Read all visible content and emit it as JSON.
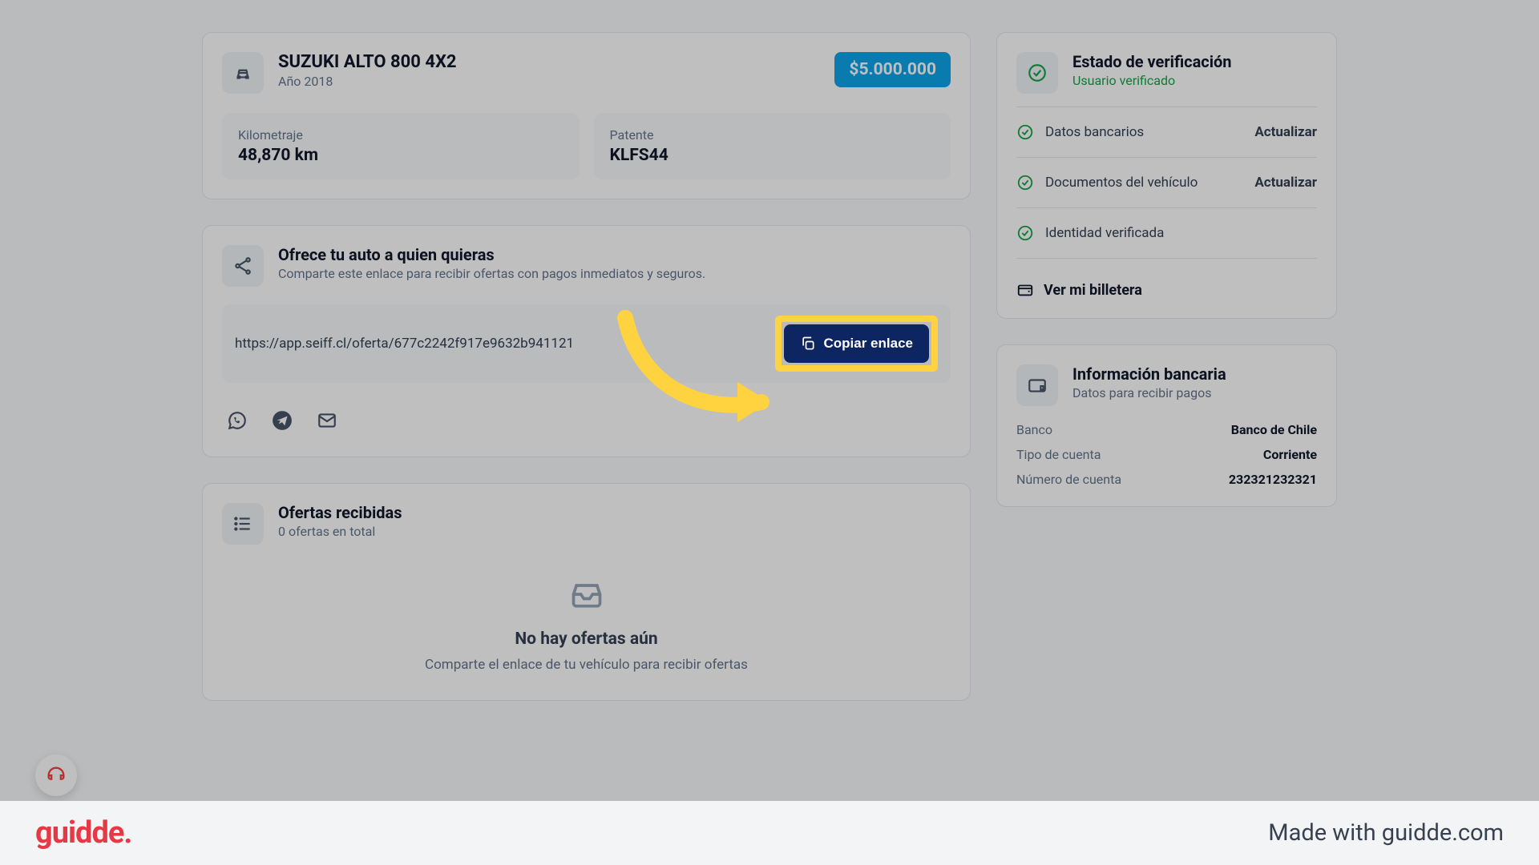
{
  "vehicle": {
    "title": "SUZUKI ALTO 800 4X2",
    "year_label": "Año 2018",
    "price": "$5.000.000",
    "stats": {
      "km_label": "Kilometraje",
      "km_value": "48,870 km",
      "plate_label": "Patente",
      "plate_value": "KLFS44"
    }
  },
  "share": {
    "title": "Ofrece tu auto a quien quieras",
    "subtitle": "Comparte este enlace para recibir ofertas con pagos inmediatos y seguros.",
    "url": "https://app.seiff.cl/oferta/677c2242f917e9632b941121",
    "copy_label": "Copiar enlace"
  },
  "offers": {
    "title": "Ofertas recibidas",
    "subtitle": "0 ofertas en total",
    "empty_title": "No hay ofertas aún",
    "empty_sub": "Comparte el enlace de tu vehículo para recibir ofertas"
  },
  "verification": {
    "title": "Estado de verificación",
    "subtitle": "Usuario verificado",
    "items": [
      {
        "label": "Datos bancarios",
        "action": "Actualizar"
      },
      {
        "label": "Documentos del vehículo",
        "action": "Actualizar"
      },
      {
        "label": "Identidad verificada",
        "action": ""
      }
    ],
    "wallet": "Ver mi billetera"
  },
  "bank": {
    "title": "Información bancaria",
    "subtitle": "Datos para recibir pagos",
    "rows": [
      {
        "k": "Banco",
        "v": "Banco de Chile"
      },
      {
        "k": "Tipo de cuenta",
        "v": "Corriente"
      },
      {
        "k": "Número de cuenta",
        "v": "232321232321"
      }
    ]
  },
  "footer": {
    "brand": "guidde.",
    "credit": "Made with guidde.com"
  }
}
